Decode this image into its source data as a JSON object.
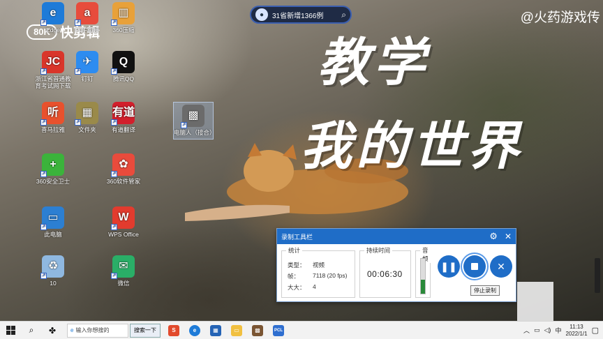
{
  "watermark": {
    "right": "@火药游戏传",
    "left_logo": "80K",
    "left_brand": "快剪辑"
  },
  "overlay": {
    "line1": "教学",
    "line2": "我的世界"
  },
  "news_pill": {
    "text": "31省新增1366例"
  },
  "desktop_icons": [
    {
      "label": "Edge",
      "color": "#1e7bd8",
      "glyph": "e"
    },
    {
      "label": "PDF阅读",
      "color": "#e74c3c",
      "glyph": "a"
    },
    {
      "label": "360压缩",
      "color": "#e8a13a",
      "glyph": "▥"
    },
    {
      "label": "浙江省普通教育考试网下载",
      "color": "#d9352a",
      "glyph": "JC"
    },
    {
      "label": "钉钉",
      "color": "#2d8cf0",
      "glyph": "✈"
    },
    {
      "label": "腾讯QQ",
      "color": "#111111",
      "glyph": "Q"
    },
    {
      "label": "喜马拉雅",
      "color": "#e8512d",
      "glyph": "听"
    },
    {
      "label": "文件夹",
      "color": "#9a8a4a",
      "glyph": "▦"
    },
    {
      "label": "有道翻译",
      "color": "#d21f2c",
      "glyph": "有道"
    },
    {
      "label": "电脑人（接合）",
      "color": "#6b6b6b",
      "glyph": "▩"
    },
    {
      "label": "360安全卫士",
      "color": "#3bb33b",
      "glyph": "+"
    },
    {
      "label": "360软件管家",
      "color": "#e94b3c",
      "glyph": "✿"
    },
    {
      "label": "此电脑",
      "color": "#2c7fd2",
      "glyph": "▭"
    },
    {
      "label": "WPS Office",
      "color": "#e23b2e",
      "glyph": "W"
    },
    {
      "label": "10",
      "color": "#8fb8e0",
      "glyph": "♻"
    },
    {
      "label": "微信",
      "color": "#2aae67",
      "glyph": "✉"
    }
  ],
  "recorder": {
    "title": "录制工具栏",
    "stats_caption": "统计",
    "type_label": "类型：",
    "type_value": "视频",
    "frames_label": "帧：",
    "frames_value": "7118 (20 fps)",
    "size_label": "大大：",
    "size_value": "4",
    "duration_caption": "持续时间",
    "duration_value": "00:06:30",
    "audio_caption": "音频",
    "tooltip": "停止录制"
  },
  "taskbar": {
    "search_placeholder": "输入你想搜的",
    "search_button": "搜索一下",
    "time": "11:13",
    "date": "2022/1/1",
    "ime": "中"
  }
}
